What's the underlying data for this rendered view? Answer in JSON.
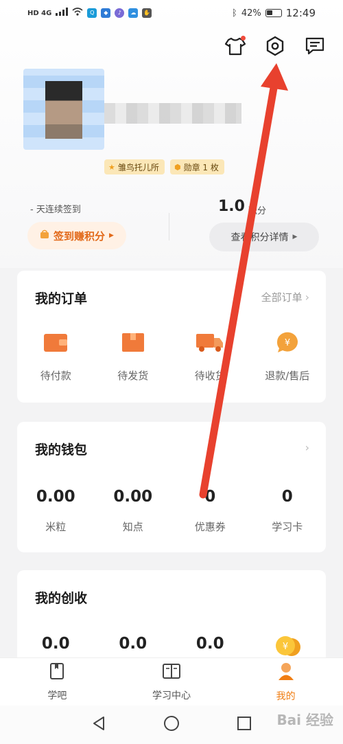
{
  "status_bar": {
    "left_text": "HD 4G",
    "battery": "42%",
    "time": "12:49"
  },
  "top_icons": [
    "shirt-icon",
    "gear-icon",
    "message-icon"
  ],
  "profile": {
    "badges": [
      {
        "icon": "star-icon",
        "label": "雏鸟托儿所"
      },
      {
        "icon": "medal-icon",
        "label": "勋章 1 枚"
      }
    ]
  },
  "checkin": {
    "streak_label": "- 天连续签到",
    "button": "签到赚积分",
    "points_value": "1.0",
    "points_unit": "积分",
    "points_button": "查看积分详情"
  },
  "orders": {
    "title": "我的订单",
    "link": "全部订单",
    "items": [
      {
        "icon": "wallet-icon",
        "label": "待付款"
      },
      {
        "icon": "box-icon",
        "label": "待发货"
      },
      {
        "icon": "truck-icon",
        "label": "待收货"
      },
      {
        "icon": "refund-icon",
        "label": "退款/售后"
      }
    ]
  },
  "wallet": {
    "title": "我的钱包",
    "items": [
      {
        "value": "0.00",
        "label": "米粒"
      },
      {
        "value": "0.00",
        "label": "知点"
      },
      {
        "value": "0",
        "label": "优惠券"
      },
      {
        "value": "0",
        "label": "学习卡"
      }
    ]
  },
  "income": {
    "title": "我的创收",
    "values": [
      "0.0",
      "0.0",
      "0.0"
    ],
    "coin_icon": "coin-icon"
  },
  "bottom_nav": [
    {
      "icon": "bookmark-icon",
      "label": "学吧"
    },
    {
      "icon": "book-icon",
      "label": "学习中心"
    },
    {
      "icon": "person-icon",
      "label": "我的",
      "active": true
    }
  ],
  "watermark": "Bai 经验",
  "colors": {
    "accent": "#f07d12",
    "arrow": "#e8412e",
    "badge": "#fbe7b7"
  }
}
